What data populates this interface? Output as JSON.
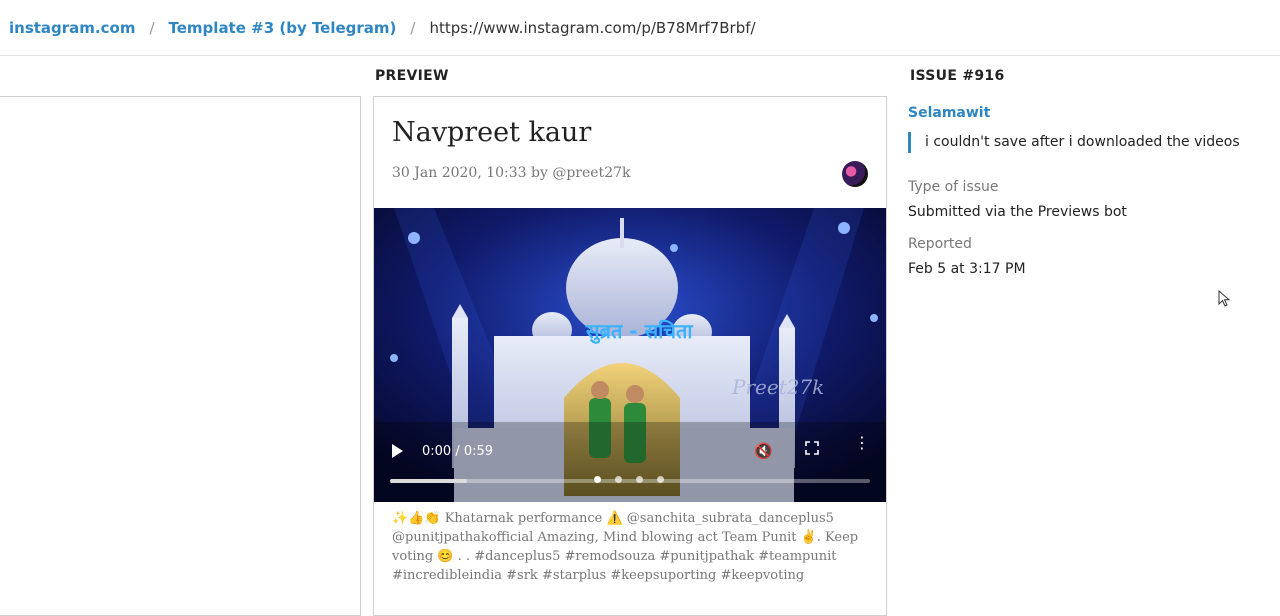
{
  "breadcrumb": {
    "site": "instagram.com",
    "template": "Template #3 (by Telegram)",
    "url": "https://www.instagram.com/p/B78Mrf7Brbf/",
    "separator": "/"
  },
  "preview": {
    "section_title": "PREVIEW",
    "post_title": "Navpreet kaur",
    "meta": "30 Jan 2020, 10:33 by @preet27k",
    "video": {
      "time": "0:00 / 0:59",
      "progress": 0.16,
      "overlay_title": "सुब्रत - सचिता",
      "watermark": "Preet27k",
      "carousel_count": 4,
      "carousel_active": 1
    },
    "caption": "✨👍👏 Khatarnak performance ⚠️ @sanchita_subrata_danceplus5 @punitjpathakofficial Amazing, Mind blowing act Team Punit ✌️. Keep voting 😊 . . #danceplus5 #remodsouza #punitjpathak #teampunit #incredibleindia #srk #starplus #keepsuporting #keepvoting"
  },
  "issue": {
    "section_title": "ISSUE #916",
    "author": "Selamawit",
    "message": "i couldn't save after i downloaded the videos",
    "type_label": "Type of issue",
    "type_value": "Submitted via the Previews bot",
    "reported_label": "Reported",
    "reported_value": "Feb 5 at 3:17 PM"
  },
  "colors": {
    "link": "#2f86c2",
    "muted": "#777777",
    "border": "#cfcfcf"
  }
}
